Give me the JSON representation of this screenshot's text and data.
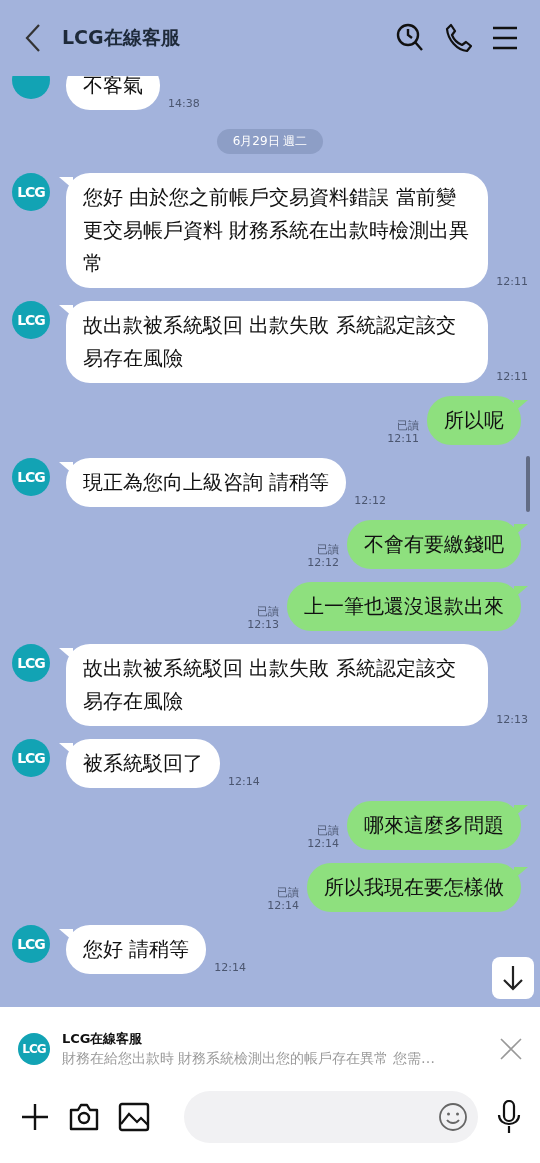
{
  "header": {
    "title": "LCG在線客服"
  },
  "messages": [
    {
      "kind": "in",
      "text": "不客氣",
      "time": "14:38"
    },
    {
      "kind": "date",
      "text": "6月29日 週二"
    },
    {
      "kind": "in",
      "avatar": "LCG",
      "text": "您好 由於您之前帳戶交易資料錯誤 當前變更交易帳戶資料 財務系統在出款時檢測出異常",
      "time": "12:11"
    },
    {
      "kind": "in",
      "avatar": "LCG",
      "text": "故出款被系統駁回 出款失敗 系統認定該交易存在風險",
      "time": "12:11"
    },
    {
      "kind": "out",
      "read": "已讀",
      "text": "所以呢",
      "time": "12:11"
    },
    {
      "kind": "in",
      "avatar": "LCG",
      "text": "現正為您向上級咨詢 請稍等",
      "time": "12:12"
    },
    {
      "kind": "out",
      "read": "已讀",
      "text": "不會有要繳錢吧",
      "time": "12:12"
    },
    {
      "kind": "out",
      "read": "已讀",
      "text": "上一筆也還沒退款出來",
      "time": "12:13"
    },
    {
      "kind": "in",
      "avatar": "LCG",
      "text": "故出款被系統駁回 出款失敗 系統認定該交易存在風險",
      "time": "12:13"
    },
    {
      "kind": "in",
      "avatar": "LCG",
      "text": "被系統駁回了",
      "time": "12:14"
    },
    {
      "kind": "out",
      "read": "已讀",
      "text": "哪來這麼多問題",
      "time": "12:14"
    },
    {
      "kind": "out",
      "read": "已讀",
      "text": "所以我現在要怎樣做",
      "time": "12:14"
    },
    {
      "kind": "in",
      "avatar": "LCG",
      "text": "您好 請稍等",
      "time": "12:14"
    }
  ],
  "notification": {
    "avatar": "LCG",
    "sender": "LCG在線客服",
    "preview": "財務在給您出款時 財務系統檢測出您的帳戶存在異常 您需…"
  }
}
